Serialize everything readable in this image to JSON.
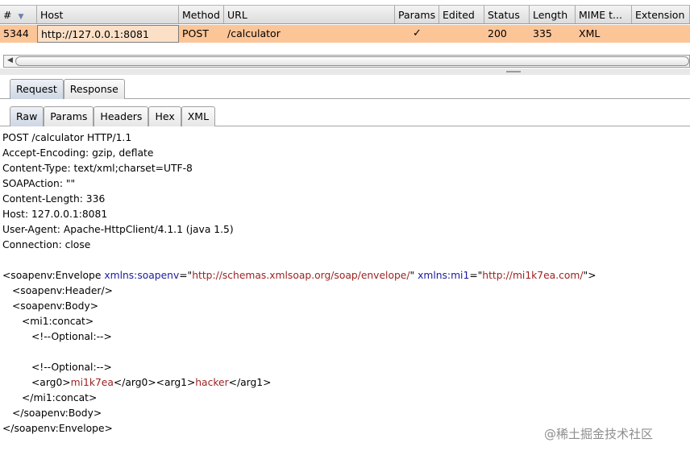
{
  "table": {
    "columns": [
      "#",
      "Host",
      "Method",
      "URL",
      "Params",
      "Edited",
      "Status",
      "Length",
      "MIME t...",
      "Extension"
    ],
    "row": {
      "num": "5344",
      "host": "http://127.0.0.1:8081",
      "method": "POST",
      "url": "/calculator",
      "params": "✓",
      "edited": "",
      "status": "200",
      "length": "335",
      "mime": "XML",
      "extension": ""
    }
  },
  "tabs": {
    "request": "Request",
    "response": "Response"
  },
  "subtabs": {
    "raw": "Raw",
    "params": "Params",
    "headers": "Headers",
    "hex": "Hex",
    "xml": "XML"
  },
  "request": {
    "request_line": "POST /calculator HTTP/1.1",
    "headers": [
      "Accept-Encoding: gzip, deflate",
      "Content-Type: text/xml;charset=UTF-8",
      "SOAPAction: \"\"",
      "Content-Length: 336",
      "Host: 127.0.0.1:8081",
      "User-Agent: Apache-HttpClient/4.1.1 (java 1.5)",
      "Connection: close"
    ],
    "xml": {
      "env_open_tag": "<soapenv:Envelope ",
      "attr1_name": "xmlns:soapenv",
      "attr1_eq": "=\"",
      "attr1_value": "http://schemas.xmlsoap.org/soap/envelope/",
      "attr1_close": "\" ",
      "attr2_name": "xmlns:mi1",
      "attr2_eq": "=\"",
      "attr2_value": "http://mi1k7ea.com/",
      "attr2_close": "\">",
      "header": "<soapenv:Header/>",
      "body_open": "<soapenv:Body>",
      "concat_open": "<mi1:concat>",
      "comment1": "<!--Optional:-->",
      "comment2": "<!--Optional:-->",
      "arg0_open": "<arg0>",
      "arg0_value": "mi1k7ea",
      "arg0_close_arg1_open": "</arg0><arg1>",
      "arg1_value": "hacker",
      "arg1_close": "</arg1>",
      "concat_close": "</mi1:concat>",
      "body_close": "</soapenv:Body>",
      "env_close": "</soapenv:Envelope>"
    }
  },
  "watermark": "@稀土掘金技术社区"
}
